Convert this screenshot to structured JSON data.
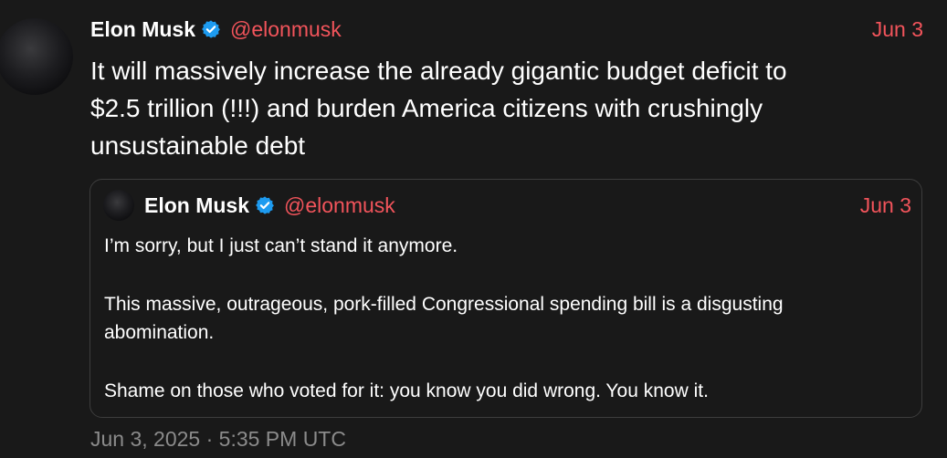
{
  "tweet": {
    "author_name": "Elon Musk",
    "handle": "@elonmusk",
    "date": "Jun 3",
    "text_lines": [
      "It will massively increase the already gigantic budget deficit to",
      "$2.5 trillion (!!!) and burden America citizens with crushingly",
      "unsustainable debt"
    ],
    "timestamp": "Jun 3, 2025 · 5:35 PM UTC"
  },
  "quote": {
    "author_name": "Elon Musk",
    "handle": "@elonmusk",
    "date": "Jun 3",
    "lines": [
      "I’m sorry, but I just can’t stand it anymore.",
      "This massive, outrageous, pork-filled Congressional spending bill is a disgusting",
      "abomination.",
      "Shame on those who voted for it: you know you did wrong. You know it."
    ]
  },
  "colors": {
    "background": "#191919",
    "accent": "#f2545b",
    "verified": "#1d9bf0",
    "muted": "#8b8b8b",
    "border": "#3d3d3d"
  },
  "icons": {
    "verified": "verified-badge-icon"
  }
}
